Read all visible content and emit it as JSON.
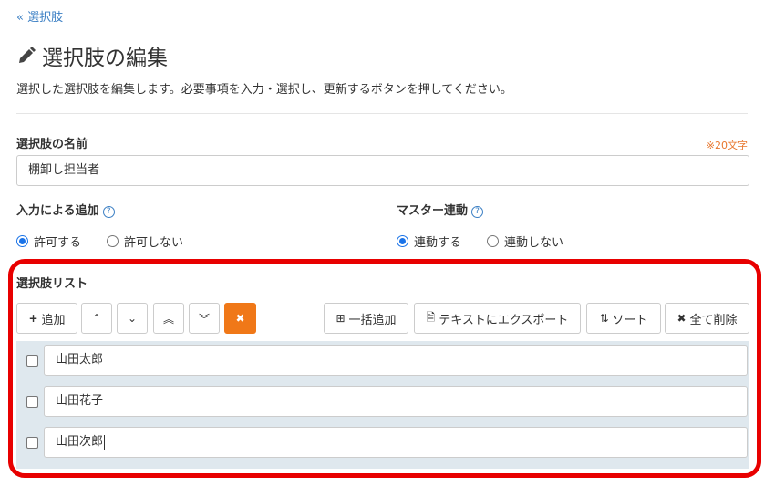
{
  "back_link": "« 選択肢",
  "title": "選択肢の編集",
  "description": "選択した選択肢を編集します。必要事項を入力・選択し、更新するボタンを押してください。",
  "name_field": {
    "label": "選択肢の名前",
    "limit_note": "※20文字",
    "value": "棚卸し担当者"
  },
  "input_add": {
    "label": "入力による追加",
    "help": "?",
    "options": [
      "許可する",
      "許可しない"
    ],
    "selected": 0
  },
  "master_link": {
    "label": "マスター連動",
    "help": "?",
    "options": [
      "連動する",
      "連動しない"
    ],
    "selected": 0
  },
  "list": {
    "label": "選択肢リスト",
    "toolbar": {
      "add": "追加",
      "up": "⌃",
      "down": "⌄",
      "top": "︽",
      "bottom": "︾",
      "delete": "✖",
      "bulk_add": "一括追加",
      "export": "テキストにエクスポート",
      "sort": "ソート",
      "delete_all": "全て削除"
    },
    "items": [
      "山田太郎",
      "山田花子",
      "山田次郎"
    ]
  },
  "colors": {
    "accent": "#3b7fc4",
    "danger": "#f07818",
    "highlight": "#e80000",
    "list_bg": "#dfe8ee"
  }
}
